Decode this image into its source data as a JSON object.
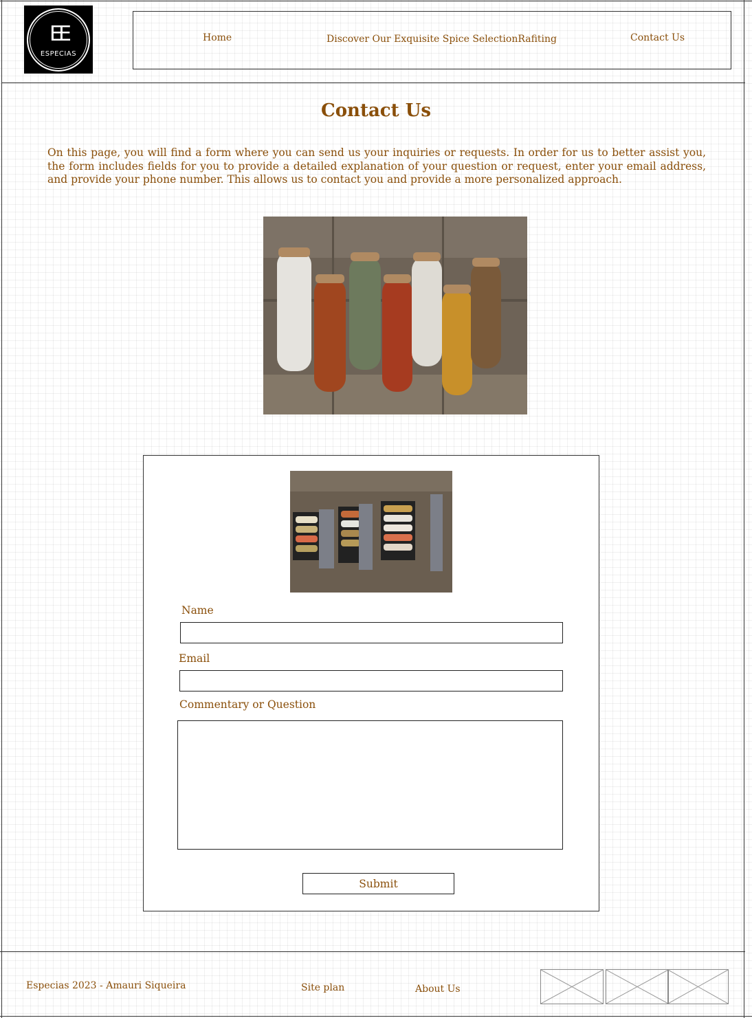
{
  "brand": {
    "logo_text": "ESPECIAS",
    "logo_mark": "EE"
  },
  "nav": {
    "home": "Home",
    "spices": "Discover Our Exquisite Spice SelectionRafiting",
    "contact": "Contact Us"
  },
  "main": {
    "title": "Contact Us",
    "intro": "On this page, you will find a form where you can send us your inquiries or requests. In order for us to better assist you, the form includes fields for you to provide a detailed explanation of your question or request, enter your email address, and provide your phone number. This allows us to contact you and provide a more personalized approach."
  },
  "form": {
    "name_label": "Name",
    "name_value": "",
    "email_label": "Email",
    "email_value": "",
    "comment_label": "Commentary or Question",
    "comment_value": "",
    "submit_label": "Submit"
  },
  "footer": {
    "copyright": "Especias  2023 - Amauri Siqueira",
    "site_plan": "Site plan",
    "about": "About Us"
  },
  "colors": {
    "accent": "#8a4f0a",
    "line": "#333333"
  }
}
